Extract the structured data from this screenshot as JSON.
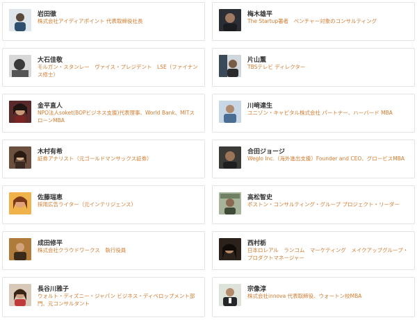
{
  "colors": {
    "name": "#333333",
    "title": "#d47a2c",
    "border": "#e3e3e3"
  },
  "profiles": [
    {
      "name": "岩田徹",
      "title": "株式会社アイディアポイント 代表取締役社長",
      "avatar": "person-photo"
    },
    {
      "name": "梅木雄平",
      "title": "The Startup著者　ベンチャー対象のコンサルティング",
      "avatar": "person-photo"
    },
    {
      "name": "大石佳敬",
      "title": "モルガン・スタンレー　ヴァイス・プレジデント　LSE（ファイナンス修士）",
      "avatar": "person-photo"
    },
    {
      "name": "片山薫",
      "title": "TBSテレビ ディレクター",
      "avatar": "person-photo"
    },
    {
      "name": "金平直人",
      "title": "NPO法人soket(BOPビジネス支援)代表理事、World Bank、MITスローンMBA",
      "avatar": "person-photo"
    },
    {
      "name": "川﨑達生",
      "title": "ユニゾン・キャピタル株式会社 パートナー、ハーバード MBA",
      "avatar": "person-photo"
    },
    {
      "name": "木村有希",
      "title": "証券アナリスト（元ゴールドマンサックス証券）",
      "avatar": "person-photo"
    },
    {
      "name": "合田ジョージ",
      "title": "Weglo Inc.（海外進出支援）Founder and CEO、グロービスMBA",
      "avatar": "person-photo"
    },
    {
      "name": "佐藤瑞恵",
      "title": "採用広告ライター（元インテリジェンス）",
      "avatar": "person-photo"
    },
    {
      "name": "高松智史",
      "title": "ボストン・コンサルティング・グループ プロジェクト・リーダー",
      "avatar": "person-photo"
    },
    {
      "name": "成田修平",
      "title": "株式会社クラウドワークス　執行役員",
      "avatar": "person-photo"
    },
    {
      "name": "西村栃",
      "title": "日本ロレアル　ランコム　マーケティング　メイクアップグループ・プロダクトマネージャー",
      "avatar": "person-photo"
    },
    {
      "name": "長谷川雅子",
      "title": "ウォルト・ディズニー・ジャパン ビジネス・ディベロップメント部門、元コンサルタント",
      "avatar": "person-photo"
    },
    {
      "name": "宗像淳",
      "title": "株式会社innova 代表取締役、ウォートン校MBA",
      "avatar": "person-photo"
    }
  ]
}
